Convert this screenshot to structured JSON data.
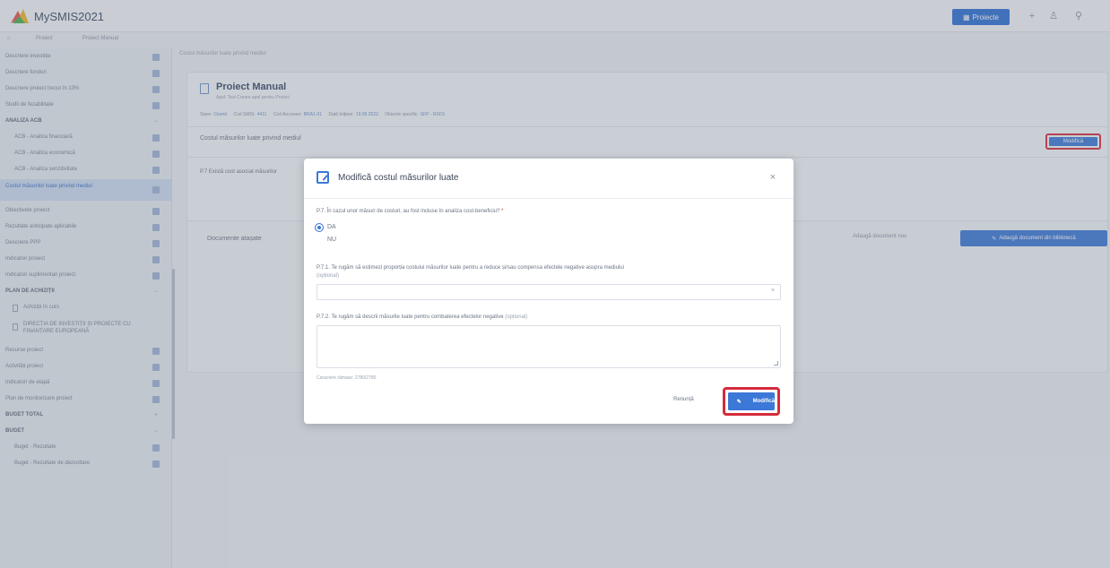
{
  "app": {
    "title": "MySMIS2021"
  },
  "topbar": {
    "projects_button": "Proiecte"
  },
  "breadcrumb": {
    "items": [
      "Proiect",
      "Proiect Manual"
    ]
  },
  "sidebar": {
    "items": [
      {
        "label": "Descriere investiție",
        "kind": "item"
      },
      {
        "label": "Descriere fonduri",
        "kind": "item"
      },
      {
        "label": "Descriere proiect trecut în 10%",
        "kind": "item"
      },
      {
        "label": "Studii de fezabilitate",
        "kind": "item"
      },
      {
        "label": "ANALIZA ACB",
        "kind": "head"
      },
      {
        "label": "ACB - Analiza financiară",
        "kind": "sub"
      },
      {
        "label": "ACB - Analiza economică",
        "kind": "sub"
      },
      {
        "label": "ACB - Analiza senzitivitate",
        "kind": "sub"
      },
      {
        "label": "Costul măsurilor luate privind mediul",
        "kind": "active"
      },
      {
        "label": "Obiectivele proiect",
        "kind": "item"
      },
      {
        "label": "Rezultate anticipate aplicabile",
        "kind": "item"
      },
      {
        "label": "Descriere PPP",
        "kind": "item"
      },
      {
        "label": "Indicatori proiect",
        "kind": "item"
      },
      {
        "label": "Indicatori suplimentari proiect",
        "kind": "item"
      },
      {
        "label": "PLAN DE ACHIZIȚII",
        "kind": "head"
      },
      {
        "label": "Achiziții în curs",
        "kind": "doc"
      },
      {
        "label": "DIRECȚIA DE INVESTIȚII ȘI PROIECTE CU FINANȚARE EUROPEANĂ",
        "kind": "doc2"
      },
      {
        "label": "Resurse proiect",
        "kind": "item"
      },
      {
        "label": "Activități proiect",
        "kind": "item"
      },
      {
        "label": "Indicatori de etapă",
        "kind": "item"
      },
      {
        "label": "Plan de monitorizare proiect",
        "kind": "item"
      },
      {
        "label": "BUGET TOTAL",
        "kind": "head"
      },
      {
        "label": "BUGET",
        "kind": "head"
      },
      {
        "label": "Buget - Rezultate",
        "kind": "sub"
      },
      {
        "label": "Buget - Rezultate de dezvoltare",
        "kind": "sub"
      }
    ]
  },
  "main": {
    "topline": "Costul măsurilor luate privind mediul",
    "project": {
      "title": "Proiect Manual",
      "subtitle": "Apel: Test Creare apel pentru Proiect",
      "meta": [
        {
          "k": "Stare:",
          "v": "Ciornă"
        },
        {
          "k": "Cod SMIS:",
          "v": "4411"
        },
        {
          "k": "Cod Ancorare:",
          "v": "BRA1-01"
        },
        {
          "k": "Dată Inițiere:",
          "v": "19.09.2022"
        },
        {
          "k": "Obiectiv specific:",
          "v": "SFP - RSO1"
        }
      ]
    },
    "section_title": "Costul măsurilor luate privind mediul",
    "modify_button": "Modifică",
    "section_q_short": "P.7 Există cost asociat măsurilor",
    "docs_title": "Documente atașate",
    "docs_add_new": "Adaugă document nou",
    "docs_add_from_lib": "Adaugă document din bibliotecă"
  },
  "modal": {
    "title": "Modifică costul măsurilor luate",
    "q1": "P.7. În cazul unor măsuri de costuri, au fost incluse în analiza cost-beneficiu?",
    "q1_required": "*",
    "yes": "DA",
    "no": "NU",
    "q2": "P.7.1. Te rugăm să estimezi proporția costului măsurilor luate pentru a reduce și/sau compensa efectele negative asupra mediului",
    "q2_optional": "(opțional)",
    "q3": "P.7.2. Te rugăm să descrii măsurile luate pentru combaterea efectelor negative",
    "q3_optional": "(opțional)",
    "counter": "Caractere rămase: 2780/2780",
    "cancel": "Renunță",
    "submit": "Modifică"
  },
  "colors": {
    "accent": "#3b78d8",
    "highlight": "#d62b3a"
  }
}
